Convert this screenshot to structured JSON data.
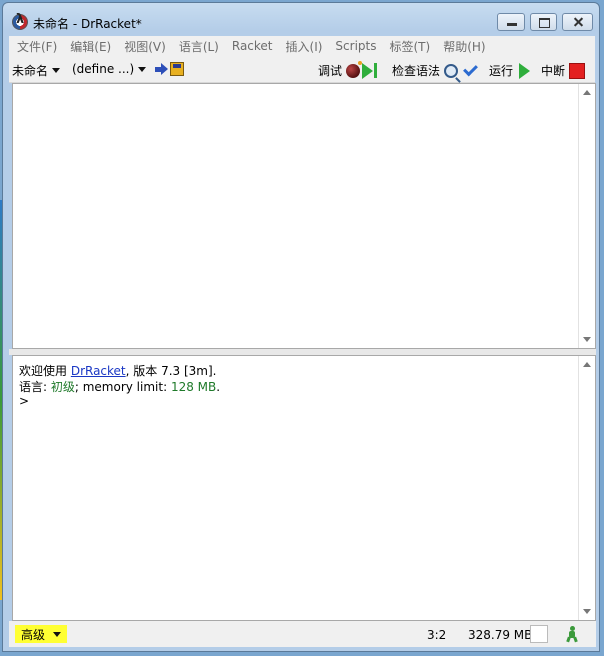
{
  "window": {
    "title": "未命名 - DrRacket*"
  },
  "menu": [
    "文件(F)",
    "编辑(E)",
    "视图(V)",
    "语言(L)",
    "Racket",
    "插入(I)",
    "Scripts",
    "标签(T)",
    "帮助(H)"
  ],
  "toolbar": {
    "file_name": "未命名",
    "define_menu": "(define ...)",
    "debug": "调试",
    "check_syntax": "检查语法",
    "run": "运行",
    "stop": "中断"
  },
  "repl": {
    "welcome_prefix": "欢迎使用 ",
    "welcome_link": "DrRacket",
    "welcome_suffix": ", 版本 7.3 [3m].",
    "language_prefix": "语言: ",
    "language_name": "初级",
    "language_mid": "; memory limit: ",
    "memory_limit": "128 MB",
    "language_end": ".",
    "prompt": ">"
  },
  "status": {
    "language_level": "高级",
    "position": "3:2",
    "memory": "328.79 MB"
  },
  "colors": {
    "level_highlight": "#ffff33",
    "link": "#1a37c4",
    "language_green": "#1f7a2a",
    "stop_red": "#e32020",
    "run_green": "#2fae3c"
  },
  "icons": [
    "racket-logo-icon",
    "debug-bomb-icon",
    "step-icon",
    "magnifier-icon",
    "check-icon",
    "run-icon",
    "stop-icon",
    "save-icon",
    "running-man-icon"
  ]
}
